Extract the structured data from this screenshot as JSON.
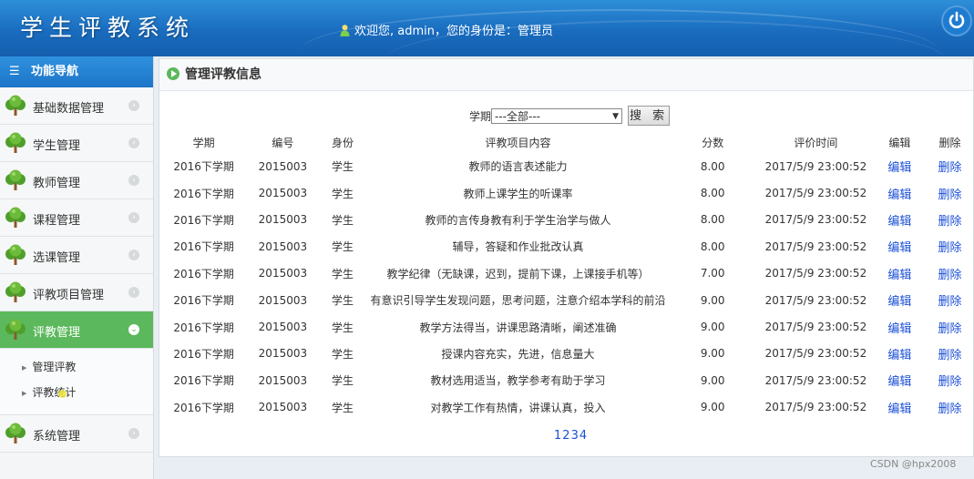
{
  "header": {
    "app_title": "学生评教系统",
    "welcome": "欢迎您, admin，您的身份是：管理员"
  },
  "sidebar": {
    "heading": "功能导航",
    "items": [
      {
        "label": "基础数据管理"
      },
      {
        "label": "学生管理"
      },
      {
        "label": "教师管理"
      },
      {
        "label": "课程管理"
      },
      {
        "label": "选课管理"
      },
      {
        "label": "评教项目管理"
      },
      {
        "label": "评教管理",
        "active": true
      },
      {
        "label": "系统管理"
      }
    ],
    "sub_items": [
      {
        "label": "管理评教"
      },
      {
        "label": "评教统计"
      }
    ]
  },
  "main": {
    "title": "管理评教信息",
    "filter": {
      "label": "学期",
      "selected": "---全部---",
      "search_label": "搜 索"
    },
    "columns": [
      "学期",
      "编号",
      "身份",
      "评教项目内容",
      "分数",
      "评价时间",
      "编辑",
      "删除"
    ],
    "rows": [
      {
        "term": "2016下学期",
        "id": "2015003",
        "role": "学生",
        "content": "教师的语言表述能力",
        "score": "8.00",
        "time": "2017/5/9 23:00:52",
        "edit": "编辑",
        "del": "删除"
      },
      {
        "term": "2016下学期",
        "id": "2015003",
        "role": "学生",
        "content": "教师上课学生的听课率",
        "score": "8.00",
        "time": "2017/5/9 23:00:52",
        "edit": "编辑",
        "del": "删除"
      },
      {
        "term": "2016下学期",
        "id": "2015003",
        "role": "学生",
        "content": "教师的言传身教有利于学生治学与做人",
        "score": "8.00",
        "time": "2017/5/9 23:00:52",
        "edit": "编辑",
        "del": "删除"
      },
      {
        "term": "2016下学期",
        "id": "2015003",
        "role": "学生",
        "content": "辅导，答疑和作业批改认真",
        "score": "8.00",
        "time": "2017/5/9 23:00:52",
        "edit": "编辑",
        "del": "删除"
      },
      {
        "term": "2016下学期",
        "id": "2015003",
        "role": "学生",
        "content": "教学纪律（无缺课，迟到，提前下课，上课接手机等）",
        "score": "7.00",
        "time": "2017/5/9 23:00:52",
        "edit": "编辑",
        "del": "删除"
      },
      {
        "term": "2016下学期",
        "id": "2015003",
        "role": "学生",
        "content": "有意识引导学生发现问题，思考问题，注意介绍本学科的前沿",
        "score": "9.00",
        "time": "2017/5/9 23:00:52",
        "edit": "编辑",
        "del": "删除"
      },
      {
        "term": "2016下学期",
        "id": "2015003",
        "role": "学生",
        "content": "教学方法得当，讲课思路清晰，阐述准确",
        "score": "9.00",
        "time": "2017/5/9 23:00:52",
        "edit": "编辑",
        "del": "删除"
      },
      {
        "term": "2016下学期",
        "id": "2015003",
        "role": "学生",
        "content": "授课内容充实，先进，信息量大",
        "score": "9.00",
        "time": "2017/5/9 23:00:52",
        "edit": "编辑",
        "del": "删除"
      },
      {
        "term": "2016下学期",
        "id": "2015003",
        "role": "学生",
        "content": "教材选用适当，教学参考有助于学习",
        "score": "9.00",
        "time": "2017/5/9 23:00:52",
        "edit": "编辑",
        "del": "删除"
      },
      {
        "term": "2016下学期",
        "id": "2015003",
        "role": "学生",
        "content": "对教学工作有热情，讲课认真，投入",
        "score": "9.00",
        "time": "2017/5/9 23:00:52",
        "edit": "编辑",
        "del": "删除"
      }
    ],
    "pages": [
      "1",
      "2",
      "3",
      "4"
    ]
  },
  "watermark": "CSDN @hpx2008",
  "colors": {
    "header_blue": "#1a6cbf",
    "active_green": "#5cb85c",
    "link_blue": "#1a4fd6"
  },
  "icons": {
    "nav": "tree-icon",
    "header_user": "user-icon",
    "power": "power-icon",
    "panel": "play-icon"
  }
}
